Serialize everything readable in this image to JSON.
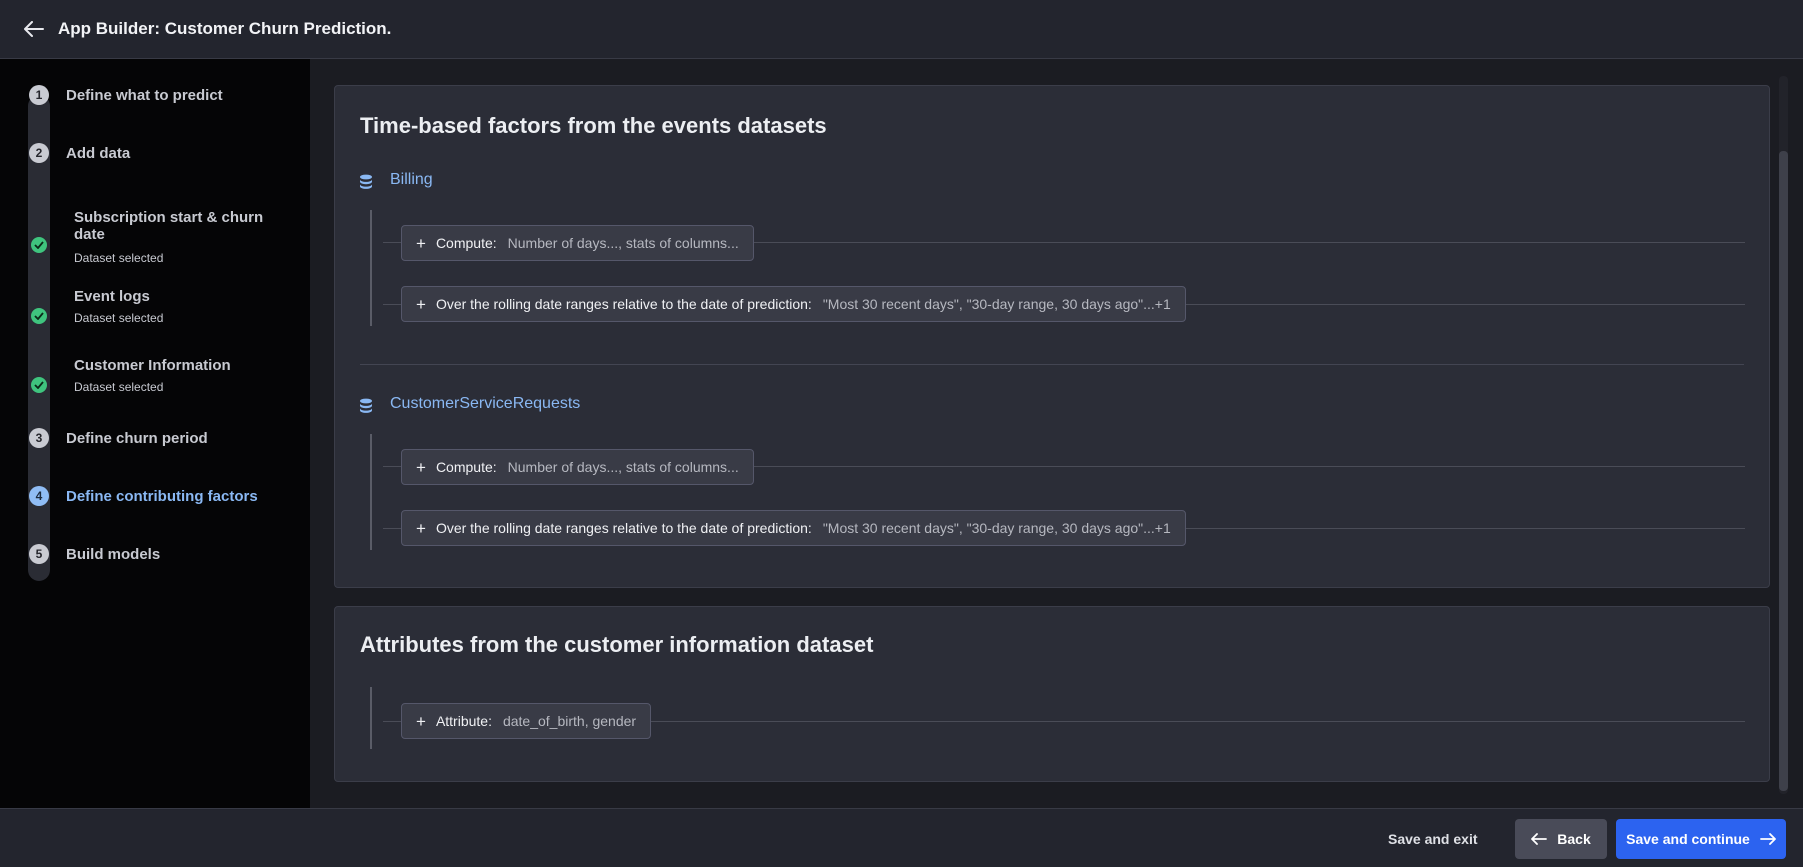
{
  "header": {
    "title": "App Builder: Customer Churn Prediction.",
    "back_icon": "arrow-left-icon"
  },
  "sidebar": {
    "steps": [
      {
        "number": "1",
        "label": "Define what to predict"
      },
      {
        "number": "2",
        "label": "Add data"
      },
      {
        "number": "3",
        "label": "Define churn period"
      },
      {
        "number": "4",
        "label": "Define contributing factors",
        "active": true
      },
      {
        "number": "5",
        "label": "Build models"
      }
    ],
    "substeps": [
      {
        "title": "Subscription start & churn date",
        "status": "Dataset selected"
      },
      {
        "title": "Event logs",
        "status": "Dataset selected"
      },
      {
        "title": "Customer Information",
        "status": "Dataset selected"
      }
    ]
  },
  "time_factors": {
    "title": "Time-based factors from the events datasets",
    "datasets": [
      {
        "name": "Billing",
        "compute": {
          "key": "Compute:",
          "value": "Number of days..., stats of columns..."
        },
        "range": {
          "key": "Over the rolling date ranges relative to the date of prediction:",
          "value": "\"Most 30 recent days\", \"30-day range, 30 days ago\"...+1"
        }
      },
      {
        "name": "CustomerServiceRequests",
        "compute": {
          "key": "Compute:",
          "value": "Number of days..., stats of columns..."
        },
        "range": {
          "key": "Over the rolling date ranges relative to the date of prediction:",
          "value": "\"Most 30 recent days\", \"30-day range, 30 days ago\"...+1"
        }
      }
    ]
  },
  "attributes": {
    "title": "Attributes from the customer information dataset",
    "attribute": {
      "key": "Attribute:",
      "value": "date_of_birth, gender"
    }
  },
  "footer": {
    "save_exit": "Save and exit",
    "back": "Back",
    "save_continue": "Save and continue"
  },
  "colors": {
    "accent": "#2c63f0",
    "active_step": "#8ab8f3",
    "success": "#3fc47e"
  }
}
